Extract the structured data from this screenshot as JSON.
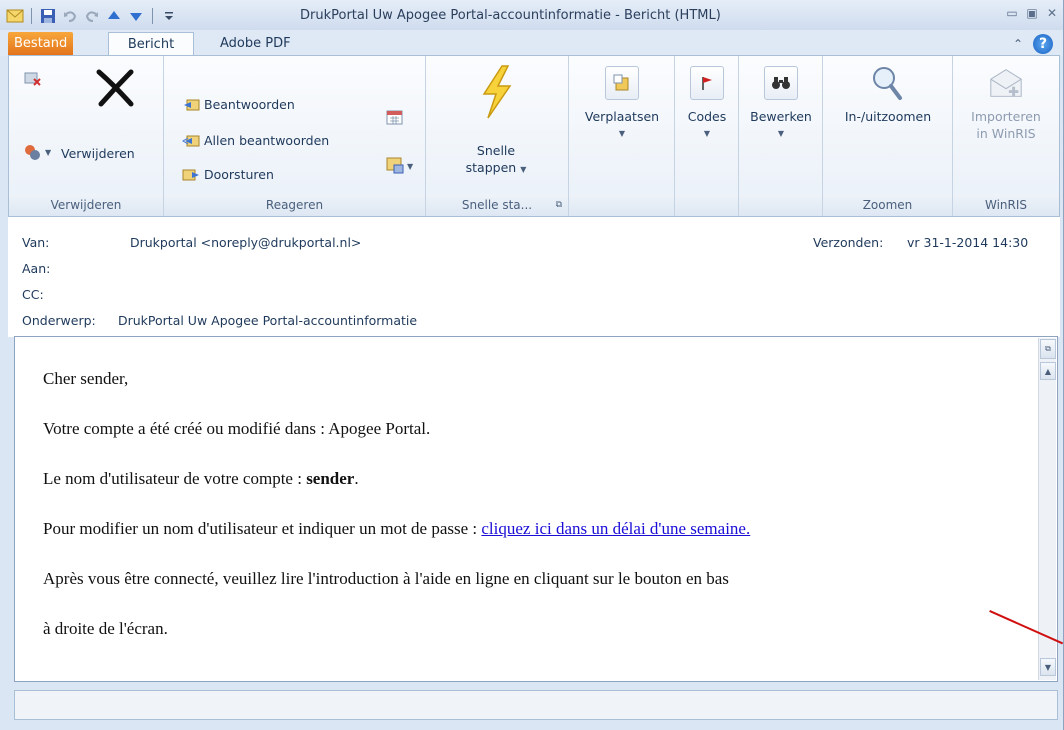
{
  "window": {
    "title": "DrukPortal Uw Apogee Portal-accountinformatie  -  Bericht (HTML)"
  },
  "quick_access": {
    "icons": [
      "mail-icon",
      "save-icon",
      "undo-icon",
      "redo-icon",
      "up-arrow-icon",
      "down-arrow-icon",
      "customize-icon"
    ]
  },
  "tabs": [
    {
      "label": "Bestand"
    },
    {
      "label": "Bericht"
    },
    {
      "label": "Adobe PDF"
    }
  ],
  "ribbon": {
    "delete_group": {
      "button": "Verwijderen",
      "label": "Verwijderen"
    },
    "respond_group": {
      "reply": "Beantwoorden",
      "reply_all": "Allen beantwoorden",
      "forward": "Doorsturen",
      "label": "Reageren"
    },
    "quicksteps_group": {
      "line1": "Snelle",
      "line2": "stappen",
      "label": "Snelle sta..."
    },
    "move_group": {
      "button": "Verplaatsen"
    },
    "tags_group": {
      "button": "Codes"
    },
    "edit_group": {
      "button": "Bewerken"
    },
    "zoom_group": {
      "button": "In-/uitzoomen",
      "label": "Zoomen"
    },
    "winris_group": {
      "line1": "Importeren",
      "line2": "in WinRIS",
      "label": "WinRIS"
    }
  },
  "header": {
    "from_label": "Van:",
    "from_value": "Drukportal <noreply@drukportal.nl>",
    "to_label": "Aan:",
    "cc_label": "CC:",
    "subject_label": "Onderwerp:",
    "subject_value": "DrukPortal Uw Apogee Portal-accountinformatie",
    "sent_label": "Verzonden:",
    "sent_value": "vr 31-1-2014 14:30"
  },
  "message": {
    "greeting": "Cher sender,",
    "line1": "Votre compte a été créé ou modifié dans : Apogee Portal.",
    "line2_prefix": "Le nom d'utilisateur de votre compte : ",
    "line2_bold": "sender",
    "line2_suffix": ".",
    "line3_prefix": "Pour modifier un nom d'utilisateur et indiquer un mot de passe : ",
    "line3_link": "cliquez ici dans un délai d'une semaine.",
    "line4": "Après vous être connecté, veuillez lire l'introduction à l'aide en ligne en cliquant sur le bouton en bas",
    "line5": "à droite de l'écran."
  },
  "colors": {
    "file_tab": "#e2711a",
    "link": "#1a0dd6",
    "annotation_line": "#d01010"
  }
}
